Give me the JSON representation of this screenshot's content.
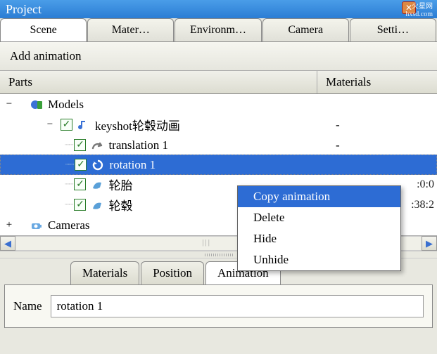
{
  "title": "Project",
  "watermark": {
    "brand": "火星网",
    "url": "hxsd.com"
  },
  "topTabs": [
    "Scene",
    "Mater…",
    "Environm…",
    "Camera",
    "Setti…"
  ],
  "addAnimation": "Add animation",
  "columns": {
    "parts": "Parts",
    "materials": "Materials"
  },
  "tree": {
    "models": {
      "label": "Models"
    },
    "keyshot": {
      "label": "keyshot轮毂动画",
      "mat": "-"
    },
    "translation": {
      "label": "translation 1",
      "mat": "-"
    },
    "rotation": {
      "label": "rotation 1"
    },
    "tire": {
      "label": "轮胎",
      "time": ":0:0"
    },
    "hub": {
      "label": "轮毂",
      "time": ":38:2"
    },
    "cameras": {
      "label": "Cameras"
    }
  },
  "context": [
    "Copy animation",
    "Delete",
    "Hide",
    "Unhide"
  ],
  "bottomTabs": [
    "Materials",
    "Position",
    "Animation"
  ],
  "name": {
    "label": "Name",
    "value": "rotation 1"
  }
}
